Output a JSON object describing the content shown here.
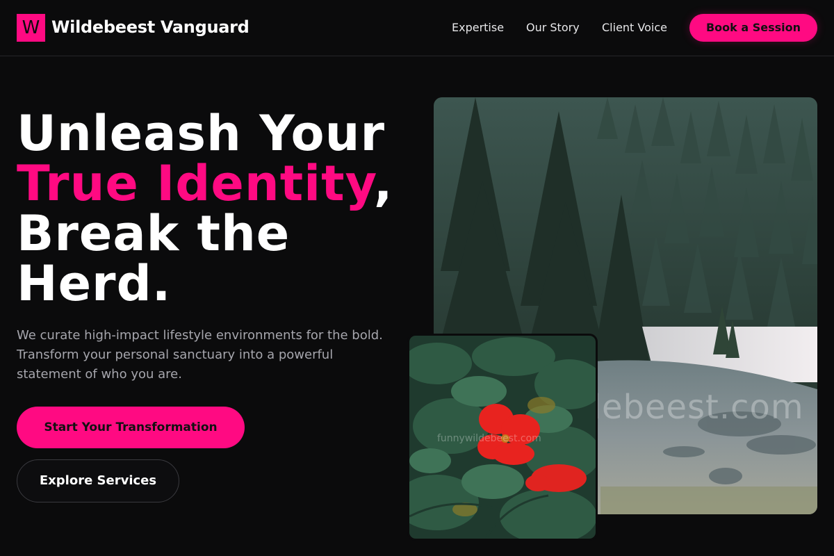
{
  "header": {
    "logo_letter": "W",
    "brand_name": "Wildebeest Vanguard",
    "nav": [
      {
        "label": "Expertise"
      },
      {
        "label": "Our Story"
      },
      {
        "label": "Client Voice"
      }
    ],
    "cta_label": "Book a Session"
  },
  "hero": {
    "headline_line1": "Unleash Your",
    "headline_accent": "True Identity",
    "headline_comma": ",",
    "headline_line3": "Break the",
    "headline_line4": "Herd.",
    "subtext": "We curate high-impact lifestyle environments for the bold. Transform your personal sanctuary into a powerful statement of who you are.",
    "primary_cta": "Start Your Transformation",
    "secondary_cta": "Explore Services"
  },
  "images": {
    "main_watermark": "funnywildebeest.com",
    "small_watermark": "funnywildebeest.com",
    "main_icon": "forest-lake-photo",
    "small_icon": "red-flower-photo"
  },
  "colors": {
    "accent": "#ff0a82",
    "background": "#0b0b0c",
    "muted_text": "#a6a6ad"
  }
}
